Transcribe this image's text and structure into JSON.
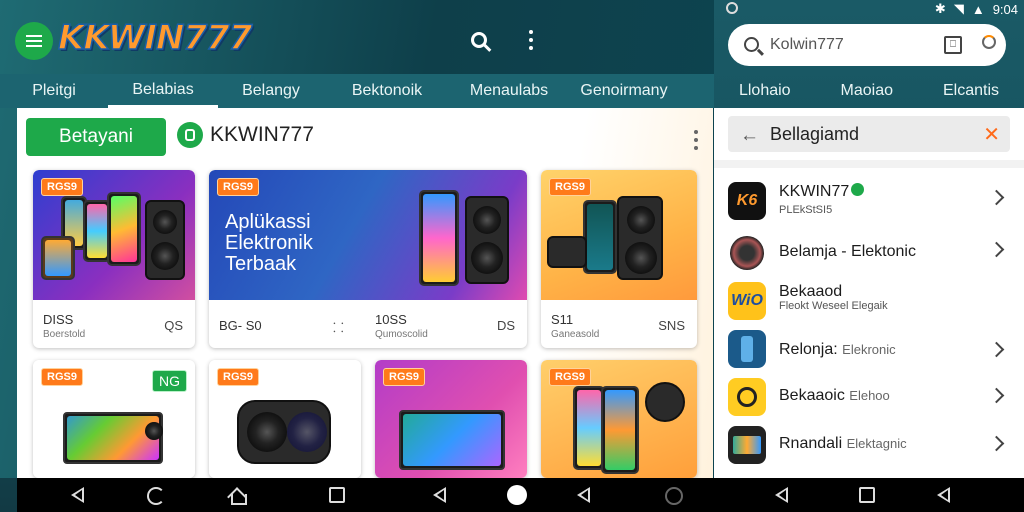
{
  "app": {
    "logo_text": "KKWIN777",
    "tabs": [
      "Pleitgi",
      "Belabias",
      "Belangy",
      "Bektonoik",
      "Menaulabs",
      "Genoirmany"
    ],
    "active_tab_index": 1,
    "primary_button": "Betayani",
    "app_name": "KKWIN777"
  },
  "cards": [
    {
      "price_tag": "RGS9",
      "footer": "DISS",
      "sub": "Boerstold",
      "right": "QS"
    },
    {
      "price_tag": "RGS9",
      "promo_lines": [
        "Aplükassi",
        "Elektronik",
        "Terbaak"
      ],
      "footer": "BG- S0",
      "mid": "⸬",
      "price": "10SS",
      "sub": "Qumoscolid",
      "right": "DS"
    },
    {
      "price_tag": "RGS9",
      "footer": "S11",
      "sub": "Ganeasold",
      "right": "SNS"
    },
    {
      "price_tag": "RGS9",
      "badge": "NG"
    },
    {
      "price_tag": "RGS9"
    },
    {
      "price_tag": "RGS9"
    },
    {
      "price_tag": "RGS9"
    }
  ],
  "status": {
    "time": "9:04"
  },
  "search": {
    "value": "Kolwin777"
  },
  "right_tabs": [
    "Llohaio",
    "Maoiao",
    "Elcantis"
  ],
  "list_search": {
    "value": "Bellagiamd"
  },
  "list_items": [
    {
      "title": "KKWIN77",
      "sub": "PLEkStSI5",
      "icon": "kk-icon",
      "verified": true
    },
    {
      "title": "Belamja - Elektonic",
      "sub": "",
      "icon": "bag-icon"
    },
    {
      "title": "Bekaaod",
      "sub": "Fleokt Weseel Elegaik",
      "icon": "wio-icon"
    },
    {
      "title": "Relonja:",
      "title_small": "Elekronic",
      "sub": "",
      "icon": "phone-icon"
    },
    {
      "title": "Bekaaoic",
      "title_small": "Elehoo",
      "sub": "",
      "icon": "yellow-icon"
    },
    {
      "title": "Rnandali",
      "title_small": "Elektagnic",
      "sub": "",
      "icon": "device-icon"
    }
  ],
  "colors": {
    "accent_green": "#1ea94a",
    "price_orange": "#ff7a1a",
    "header_teal": "#1c6470"
  }
}
